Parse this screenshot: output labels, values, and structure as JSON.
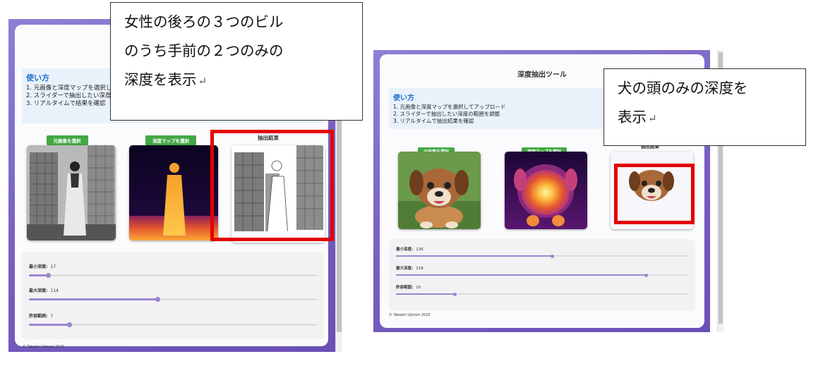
{
  "left": {
    "howto": {
      "title": "使い方",
      "steps": [
        "1. 元画像と深度マップを選択してアップロード",
        "2. スライダーで抽出したい深度の範囲を調整",
        "3. リアルタイムで結果を確認"
      ]
    },
    "buttons": {
      "source": "元画像を選択",
      "depth": "深度マップを選択"
    },
    "result_label": "抽出結果",
    "sliders": [
      {
        "label": "最小深度:",
        "value": "17",
        "fraction": 0.067
      },
      {
        "label": "最大深度:",
        "value": "114",
        "fraction": 0.447
      },
      {
        "label": "許容範囲:",
        "value": "7",
        "fraction": 0.14
      }
    ],
    "footer": "© Takeshi Ujimori 2025",
    "callout": [
      "女性の後ろの３つのビル",
      "のうち手前の２つのみの",
      "深度を表示"
    ]
  },
  "right": {
    "title": "深度抽出ツール",
    "howto": {
      "title": "使い方",
      "steps": [
        "1. 元画像と深度マップを選択してアップロード",
        "2. スライダーで抽出したい深度の範囲を調整",
        "3. リアルタイムで抽出結果を確認"
      ]
    },
    "buttons": {
      "source": "元画像を選択",
      "depth": "深度マップを選択"
    },
    "result_label": "抽出結果",
    "sliders": [
      {
        "label": "最小深度:",
        "value": "136",
        "fraction": 0.533
      },
      {
        "label": "最大深度:",
        "value": "218",
        "fraction": 0.855
      },
      {
        "label": "許容範囲:",
        "value": "10",
        "fraction": 0.2
      }
    ],
    "footer": "© Takeshi Ujimori 2025",
    "callout": [
      "犬の頭のみの深度を",
      "表示"
    ]
  },
  "colors": {
    "accent_red": "#e40000",
    "button_green": "#44a844",
    "slider": "#9b86cf",
    "heading_blue": "#1a6fcf"
  }
}
